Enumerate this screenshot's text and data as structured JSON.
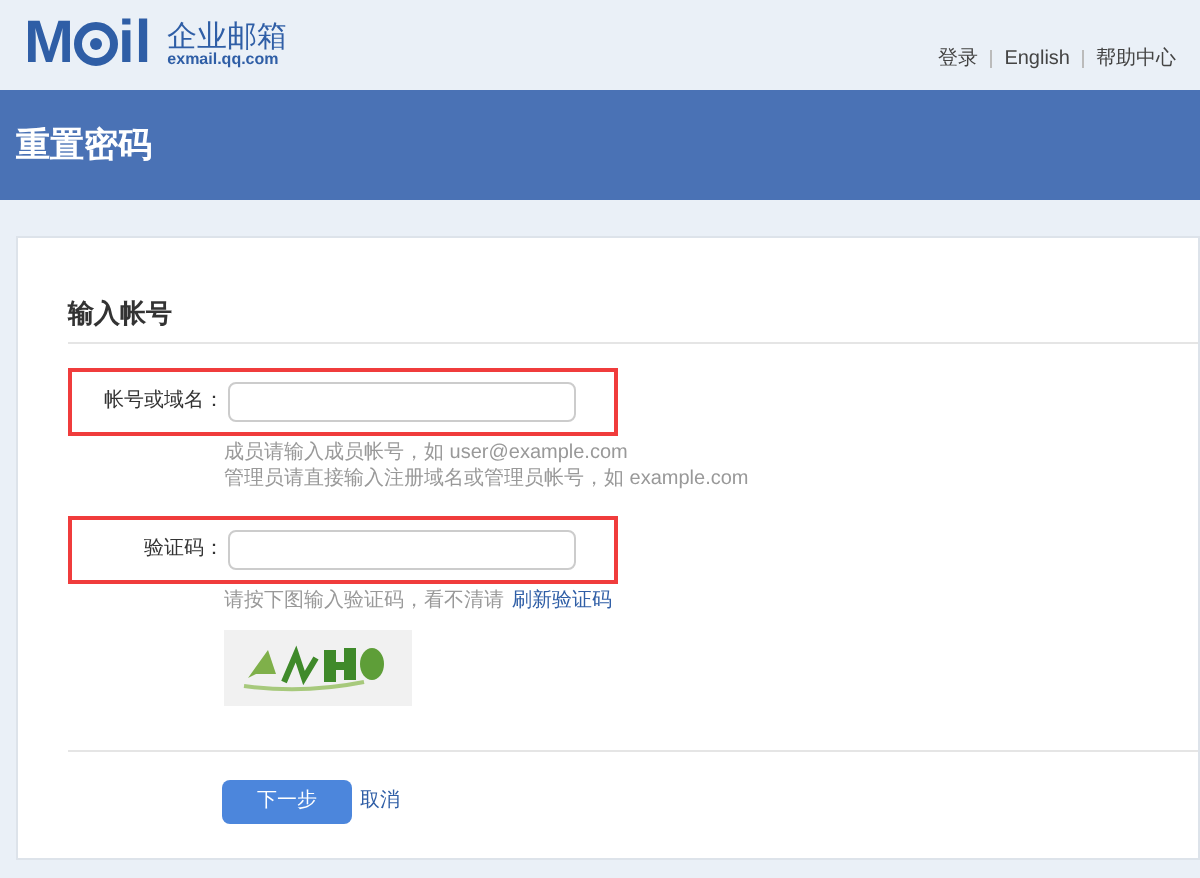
{
  "logo": {
    "parts": [
      "M",
      "il"
    ],
    "name": "企业邮箱",
    "domain": "exmail.qq.com"
  },
  "top_links": [
    "登录",
    "English",
    "帮助中心"
  ],
  "page_title": "重置密码",
  "section_title": "输入帐号",
  "fields": [
    {
      "label": "帐号或域名：",
      "highlighted": true,
      "hints": [
        "成员请输入成员帐号，如 user@example.com",
        "管理员请直接输入注册域名或管理员帐号，如 example.com"
      ]
    },
    {
      "label": "验证码：",
      "highlighted": true,
      "hints": [
        "请按下图输入验证码，看不清请"
      ],
      "link": "刷新验证码",
      "captcha": {
        "kind": "picture"
      }
    }
  ],
  "buttons": {
    "next": "下一步",
    "cancel": "取消"
  }
}
